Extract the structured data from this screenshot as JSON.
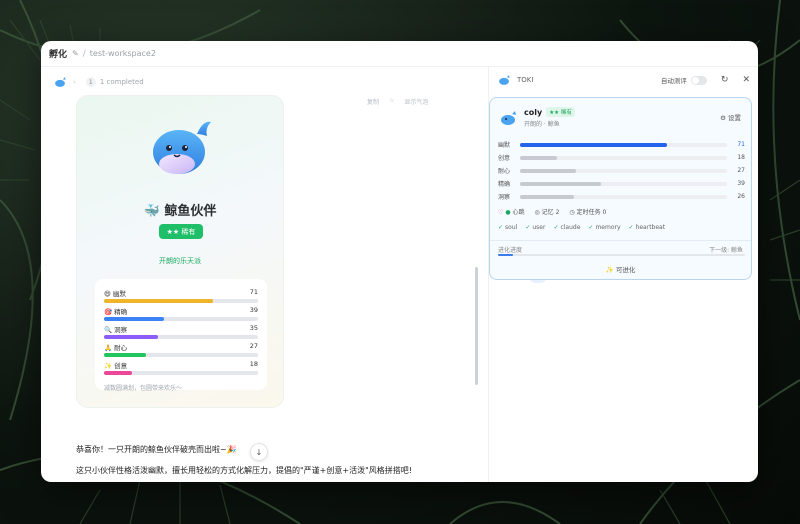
{
  "titlebar": {
    "title": "孵化",
    "workspace": "test-workspace2"
  },
  "left": {
    "crumb": {
      "count": "1",
      "status": "1 completed"
    },
    "card": {
      "title": "🐳 鲸鱼伙伴",
      "rarity": "★★ 稀有",
      "subtitle": "开朗的乐天派",
      "stats": [
        {
          "label": "😄 幽默",
          "value": 71,
          "max": 100,
          "color": "#f0b429"
        },
        {
          "label": "🎯 精确",
          "value": 39,
          "max": 100,
          "color": "#3b82f6"
        },
        {
          "label": "🔍 洞察",
          "value": 35,
          "max": 100,
          "color": "#8b5cf6"
        },
        {
          "label": "🙏 耐心",
          "value": 27,
          "max": 100,
          "color": "#22c55e"
        },
        {
          "label": "✨ 创意",
          "value": 18,
          "max": 100,
          "color": "#ec4899"
        }
      ],
      "footer": "减数圆满划，包圆带来欢乐～"
    },
    "actions": [
      "复制",
      "☆",
      "显示气泡"
    ],
    "messages": {
      "line1": "恭喜你！一只开朗的鲸鱼伙伴破壳而出啦~🎉",
      "line2": "这只小伙伴性格活泼幽默，擅长用轻松的方式化解压力，提倡的\"严谨+创意+活泼\"风格拼搭吧!"
    }
  },
  "right": {
    "header": {
      "title": "TOKI",
      "auto_label": "自动测评"
    },
    "pet": {
      "name": "coly",
      "badge": "★★ 稀有",
      "sub": "开朗的 · 鲸鱼",
      "settings": "设置",
      "stats": [
        {
          "label": "幽默",
          "value": 71,
          "max": 100,
          "color": "#2563eb"
        },
        {
          "label": "创意",
          "value": 18,
          "max": 100,
          "color": "#c7cbd1"
        },
        {
          "label": "耐心",
          "value": 27,
          "max": 100,
          "color": "#c7cbd1"
        },
        {
          "label": "精确",
          "value": 39,
          "max": 100,
          "color": "#c7cbd1"
        },
        {
          "label": "洞察",
          "value": 26,
          "max": 100,
          "color": "#c7cbd1"
        }
      ],
      "meta": {
        "mood": "心跳",
        "memory": "记忆 2",
        "timer": "定时任务 0"
      },
      "tags": [
        "soul",
        "user",
        "claude",
        "memory",
        "heartbeat"
      ],
      "evo": {
        "label": "进化进度",
        "next": "下一级: 鲸鱼",
        "progress": 0.06
      },
      "evolve": "✨ 可进化"
    }
  }
}
